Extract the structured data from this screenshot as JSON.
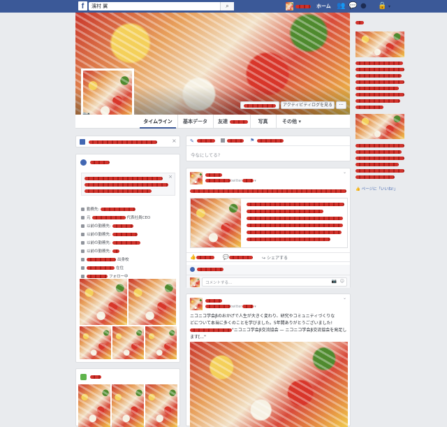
{
  "topbar": {
    "logo": "f",
    "search_value": "濱村 翼",
    "search_icon": "magnifier-icon",
    "home_label": "ホーム",
    "icons": [
      "friends-icon",
      "messages-icon",
      "globe-icon",
      "lock-icon"
    ]
  },
  "cover": {
    "activity_log_label": "アクティビティログを見る",
    "more_label": "···"
  },
  "nav": {
    "tabs": [
      "タイムライン",
      "基本データ",
      "友達",
      "写真",
      "その他 ▾"
    ]
  },
  "composer": {
    "placeholder": "今なにしてる?"
  },
  "about": {
    "rows": [
      "勤務先:",
      "元",
      "代表社員CEO",
      "以前の勤務先:",
      "以前の勤務先:",
      "以前の勤務先:",
      "以前の勤務先:",
      "出身校",
      "在住",
      "フォロー中"
    ]
  },
  "post1": {
    "source_label": "twitter",
    "like_label": "いいね!",
    "comment_label": "コメントする",
    "share_label": "シェアする",
    "comment_placeholder": "コメントする..."
  },
  "post2": {
    "source_label": "twitter",
    "body_line1": "ニコニコ学会βのおかげで人生が大きく変わり、研究やコミュニティづくりな",
    "body_line2": "どについて本当に多くのことを学びました。5年間ありがとうございました!",
    "body_line3": "\"ニコニコ学会β交流協会 — ニコニコ学会β交流協会を発足し",
    "body_line4": "ます[...\""
  },
  "rightcol": {
    "page_like_label": "ページに「いいね!」"
  }
}
